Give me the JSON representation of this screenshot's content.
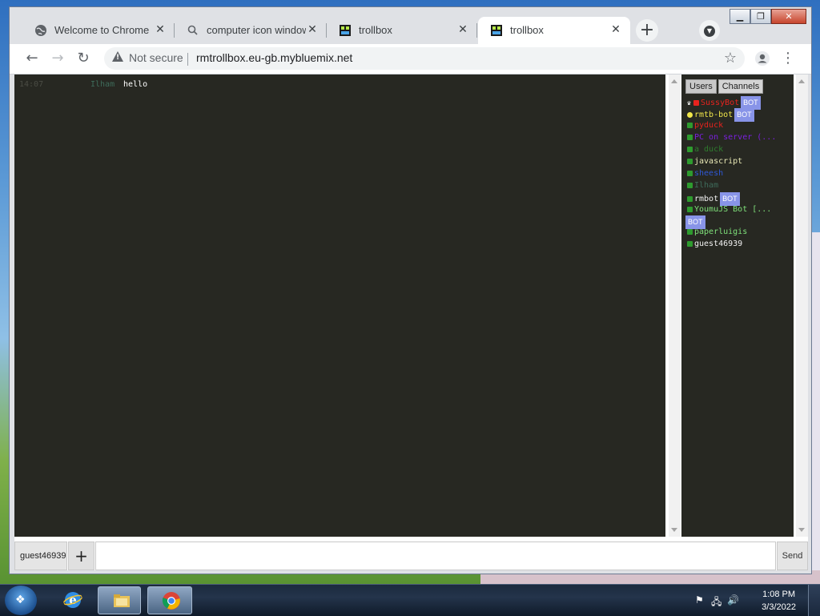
{
  "browser": {
    "tabs": [
      {
        "title": "Welcome to Chrome",
        "icon": "globe-icon"
      },
      {
        "title": "computer icon windows",
        "icon": "search-icon"
      },
      {
        "title": "trollbox",
        "icon": "trollbox-favicon"
      },
      {
        "title": "trollbox",
        "icon": "trollbox-favicon"
      }
    ],
    "active_tab_index": 3,
    "new_tab_label": "+",
    "security_label": "Not secure",
    "url": "rmtrollbox.eu-gb.mybluemix.net"
  },
  "chat": {
    "messages": [
      {
        "time": "14:07",
        "user": "Ilham",
        "text": "hello"
      }
    ]
  },
  "panel": {
    "tabs": [
      "Users",
      "Channels"
    ],
    "users": [
      {
        "name": "SussyBot",
        "color": "#e8231e",
        "dot": "#e8231e",
        "bot": true,
        "crown": true
      },
      {
        "name": "rmtb-bot",
        "color": "#f0e64a",
        "dot": "#f0e64a",
        "bot": true,
        "circle": true
      },
      {
        "name": "pyduck",
        "color": "#e8231e",
        "dot": "#2e9b2e",
        "bot": false
      },
      {
        "name": "PC on server (...",
        "color": "#7b1fe0",
        "dot": "#2e9b2e",
        "bot": false
      },
      {
        "name": "a duck",
        "color": "#2f7d2f",
        "dot": "#2e9b2e",
        "bot": false
      },
      {
        "name": "javascript",
        "color": "#e6e6b4",
        "dot": "#2e9b2e",
        "bot": false
      },
      {
        "name": "sheesh",
        "color": "#2e58d6",
        "dot": "#2e9b2e",
        "bot": false
      },
      {
        "name": "Ilham",
        "color": "#3e6b5a",
        "dot": "#2e9b2e",
        "bot": false
      },
      {
        "name": "rmbot",
        "color": "#f2f2f2",
        "dot": "#2e9b2e",
        "bot": true
      },
      {
        "name": "YoumuJS Bot [...",
        "color": "#7fe07a",
        "dot": "#2e9b2e",
        "bot": true,
        "wrap": true
      },
      {
        "name": "paperluigis",
        "color": "#7fe07a",
        "dot": "#2e9b2e",
        "bot": false
      },
      {
        "name": "guest46939",
        "color": "#f2f2f2",
        "dot": "#2e9b2e",
        "bot": false
      }
    ],
    "bot_label": "BOT"
  },
  "input": {
    "nickname": "guest46939",
    "add_label": "+",
    "message_value": "",
    "send_label": "Send"
  },
  "taskbar": {
    "apps": [
      "internet-explorer",
      "file-explorer",
      "chrome"
    ],
    "time": "1:08 PM",
    "date": "3/3/2022"
  }
}
